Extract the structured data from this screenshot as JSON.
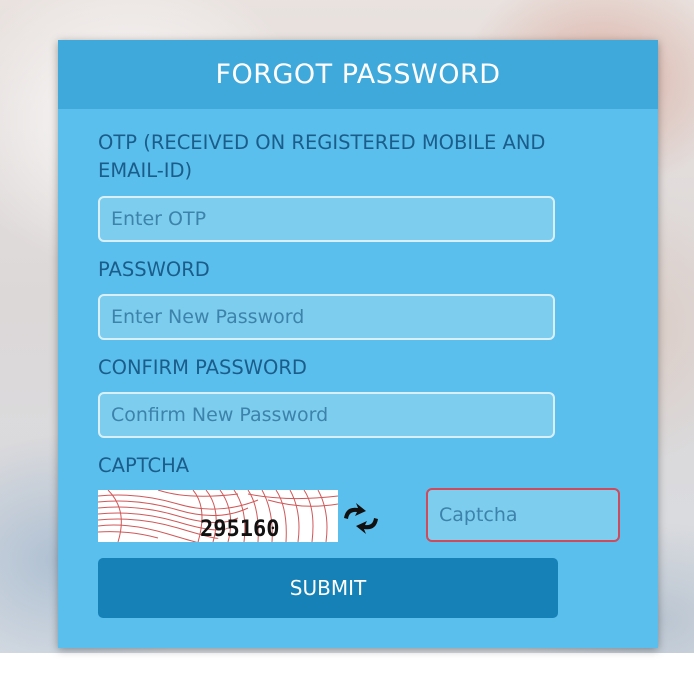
{
  "form": {
    "title": "FORGOT PASSWORD",
    "otp": {
      "label": "OTP (RECEIVED ON REGISTERED MOBILE AND EMAIL-ID)",
      "placeholder": "Enter OTP",
      "value": ""
    },
    "password": {
      "label": "PASSWORD",
      "placeholder": "Enter New Password",
      "value": ""
    },
    "confirm_password": {
      "label": "CONFIRM PASSWORD",
      "placeholder": "Confirm New Password",
      "value": ""
    },
    "captcha": {
      "label": "CAPTCHA",
      "image_text": "295160",
      "refresh_icon": "refresh-arrows-icon",
      "placeholder": "Captcha",
      "value": ""
    },
    "submit_label": "SUBMIT"
  },
  "colors": {
    "panel": "#5bbfed",
    "header": "#3fa9dc",
    "label": "#1b5d8a",
    "input_bg": "#7dcdee",
    "submit": "#1681b6",
    "captcha_error_border": "#cf4a5a"
  }
}
